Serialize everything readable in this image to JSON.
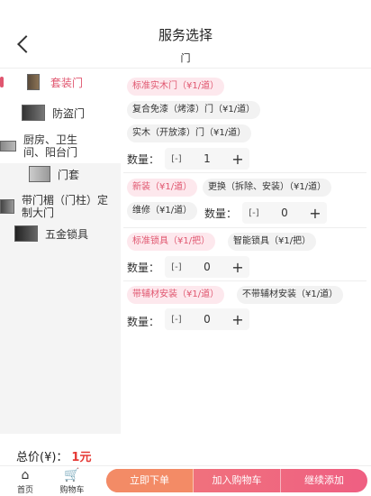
{
  "header": {
    "title": "服务选择",
    "back_icon": "chevron-left-icon"
  },
  "subheader": {
    "title": "门"
  },
  "categories": [
    {
      "label": "套装门",
      "active": true
    },
    {
      "label": "防盗门",
      "active": false
    },
    {
      "label": "厨房、卫生间、阳台门",
      "active": false
    },
    {
      "label": "门套",
      "active": false
    },
    {
      "label": "带门楣（门柱）定制大门",
      "active": false
    },
    {
      "label": "五金锁具",
      "active": false
    }
  ],
  "content": {
    "group1": {
      "options": [
        "标准实木门（¥1/道）",
        "复合免漆（烤漆）门（¥1/道）",
        "实木（开放漆）门（¥1/道）"
      ],
      "qty_label": "数量：",
      "qty": "1"
    },
    "group2": {
      "options": [
        "新装（¥1/道）",
        "更换（拆除、安装）（¥1/道）",
        "维修（¥1/道）"
      ],
      "qty_label": "数量：",
      "qty": "0"
    },
    "group3": {
      "options": [
        "标准锁具（¥1/把）",
        "智能锁具（¥1/把）"
      ],
      "qty_label": "数量：",
      "qty": "0"
    },
    "group4": {
      "options": [
        "带辅材安装（¥1/道）",
        "不带辅材安装（¥1/道）"
      ],
      "qty_label": "数量：",
      "qty": "0"
    }
  },
  "total": {
    "label": "总价(¥)：",
    "amount": "1元"
  },
  "bottom": {
    "home_label": "首页",
    "cart_label": "购物车",
    "buy_now": "立即下单",
    "add_cart": "加入购物车",
    "continue_add": "继续添加"
  },
  "colors": {
    "accent": "#e0566f",
    "price": "#e53935"
  }
}
